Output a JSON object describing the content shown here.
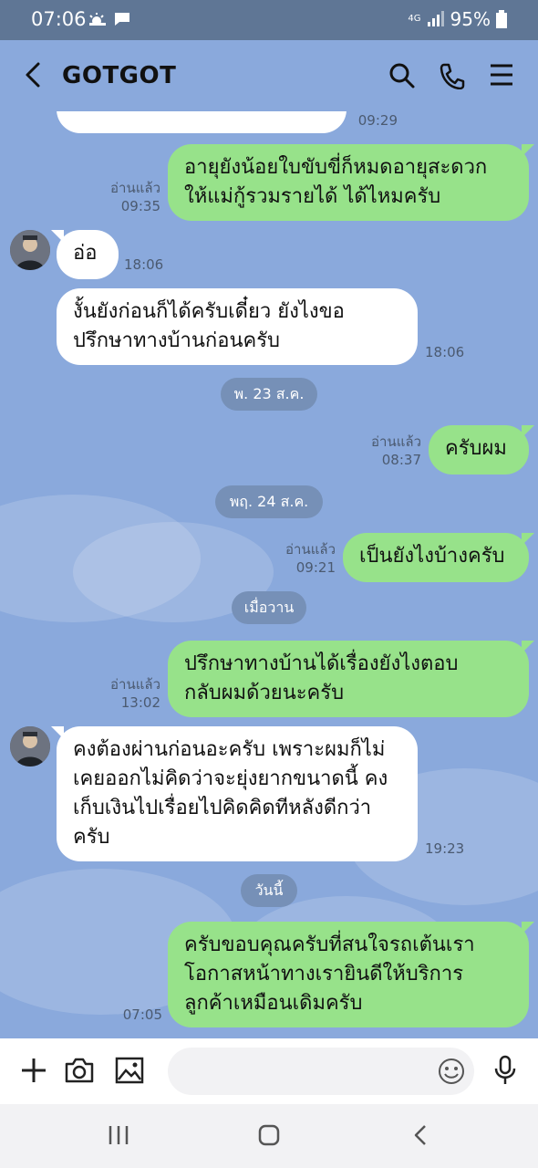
{
  "status_bar": {
    "time": "07:06",
    "network": "4G",
    "battery": "95%"
  },
  "header": {
    "title": "GOTGOT",
    "back_icon": "chevron-left-icon",
    "search_icon": "search-icon",
    "call_icon": "phone-icon",
    "menu_icon": "menu-icon"
  },
  "messages": [
    {
      "dir": "in",
      "lines": [
        ""
      ],
      "time": "09:29"
    },
    {
      "dir": "out",
      "lines": [
        "อายุยังน้อยใบขับขี่ก็หมดอายุสะดวก",
        "ให้แม่กู้รวมรายได้ ได้ไหมครับ"
      ],
      "read": "อ่านแล้ว",
      "time": "09:35"
    },
    {
      "dir": "in",
      "lines": [
        "อ่อ"
      ],
      "time": "18:06"
    },
    {
      "dir": "in",
      "lines": [
        "งั้นยังก่อนก็ได้ครับเดี๋ยว ยังไงขอ",
        "ปรึกษาทางบ้านก่อนครับ"
      ],
      "time": "18:06"
    },
    {
      "dir": "out",
      "lines": [
        "ครับผม"
      ],
      "read": "อ่านแล้ว",
      "time": "08:37"
    },
    {
      "dir": "out",
      "lines": [
        "เป็นยังไงบ้างครับ"
      ],
      "read": "อ่านแล้ว",
      "time": "09:21"
    },
    {
      "dir": "out",
      "lines": [
        "ปรึกษาทางบ้านได้เรื่องยังไงตอบ",
        "กลับผมด้วยนะครับ"
      ],
      "read": "อ่านแล้ว",
      "time": "13:02"
    },
    {
      "dir": "in",
      "lines": [
        "คงต้องผ่านก่อนอะครับ เพราะผมก็ไม่",
        "เคยออกไม่คิดว่าจะยุ่งยากขนาดนี้ คง",
        "เก็บเงินไปเรื่อยไปคิดคิดทีหลังดีกว่า",
        "ครับ"
      ],
      "time": "19:23"
    },
    {
      "dir": "out",
      "lines": [
        "ครับขอบคุณครับที่สนใจรถเต้นเรา",
        "โอกาสหน้าทางเรายินดีให้บริการ",
        "ลูกค้าเหมือนเดิมครับ"
      ],
      "time": "07:05"
    }
  ],
  "date_dividers": [
    "พ. 23 ส.ค.",
    "พฤ. 24 ส.ค.",
    "เมื่อวาน",
    "วันนี้"
  ],
  "input_bar": {
    "add_icon": "plus-icon",
    "camera_icon": "camera-icon",
    "gallery_icon": "image-icon",
    "emoji_icon": "emoji-icon",
    "mic_icon": "microphone-icon",
    "placeholder": ""
  },
  "nav_bar": {
    "recent_icon": "recent-apps-icon",
    "home_icon": "home-icon",
    "back_icon": "back-icon"
  },
  "colors": {
    "chat_bg": "#8aa9dc",
    "outgoing_bubble": "#97e28a",
    "incoming_bubble": "#ffffff",
    "status_bar": "#5f7695",
    "date_pill": "#7690b7"
  }
}
